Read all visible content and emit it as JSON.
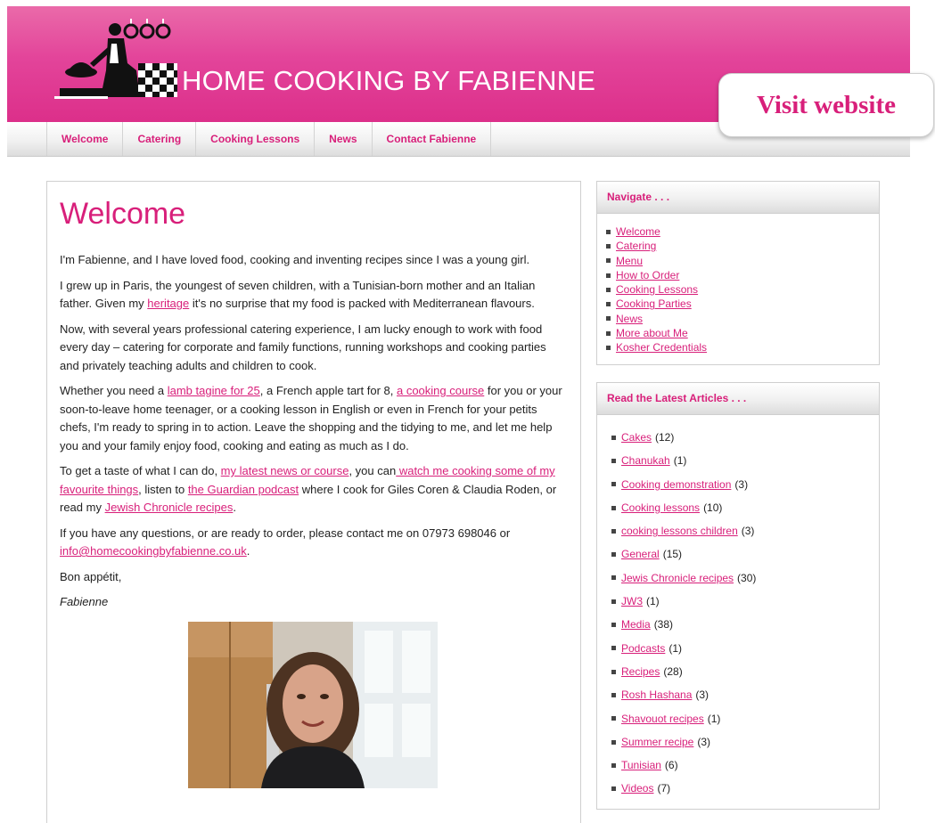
{
  "site": {
    "title": "HOME COOKING BY FABIENNE"
  },
  "topnav": [
    {
      "label": "Welcome"
    },
    {
      "label": "Catering"
    },
    {
      "label": "Cooking Lessons"
    },
    {
      "label": "News"
    },
    {
      "label": "Contact Fabienne"
    }
  ],
  "visit_label": "Visit website",
  "main": {
    "title": "Welcome",
    "p1": "I'm Fabienne, and I have loved food, cooking and inventing recipes since I was a young girl.",
    "p2": {
      "t1": "I grew up in Paris, the youngest of seven children, with a Tunisian-born mother and an Italian father. Given my ",
      "l1": "heritage",
      "t2": " it's no surprise that my food is packed with Mediterranean flavours."
    },
    "p3": "Now, with several years professional catering experience, I am lucky enough to work with food every day – catering for corporate and family functions, running workshops and cooking parties and privately teaching adults and children to cook.",
    "p4": {
      "t1": "Whether you need a ",
      "l1": "lamb tagine for 25",
      "t2": ", a French apple tart for 8, ",
      "l2": "a cooking course",
      "t3": " for you or your soon-to-leave home teenager, or a cooking lesson in English or even in French for your petits chefs, I'm ready to spring in to action. Leave the shopping and the tidying to me, and let me help you and your family enjoy food, cooking and eating as much as I do."
    },
    "p5": {
      "t1": "To get a taste of what I can do, ",
      "l1": "my latest news or course",
      "t2": ", you can",
      "l2": " watch me cooking some of my favourite things",
      "t3": ", listen to ",
      "l3": "the Guardian podcast",
      "t4": " where I cook for Giles Coren & Claudia Roden, or read my ",
      "l4": "Jewish Chronicle recipes",
      "t5": "."
    },
    "p6": {
      "t1": "If you have any questions, or are ready to order, please contact me on 07973 698046 or ",
      "l1": "info@homecookingbyfabienne.co.uk",
      "t2": "."
    },
    "closing": "Bon appétit,",
    "signature": "Fabienne"
  },
  "sidebar": {
    "navigate": {
      "title": "Navigate . . .",
      "items": [
        {
          "label": "Welcome"
        },
        {
          "label": "Catering"
        },
        {
          "label": "Menu"
        },
        {
          "label": "How to Order"
        },
        {
          "label": "Cooking Lessons"
        },
        {
          "label": "Cooking Parties"
        },
        {
          "label": "News"
        },
        {
          "label": "More about Me"
        },
        {
          "label": "Kosher Credentials"
        }
      ]
    },
    "articles": {
      "title": "Read the Latest Articles . . .",
      "items": [
        {
          "label": "Cakes",
          "count": "(12)"
        },
        {
          "label": "Chanukah",
          "count": "(1)"
        },
        {
          "label": "Cooking demonstration",
          "count": "(3)"
        },
        {
          "label": "Cooking lessons",
          "count": "(10)"
        },
        {
          "label": "cooking lessons children",
          "count": "(3)"
        },
        {
          "label": "General",
          "count": "(15)"
        },
        {
          "label": "Jewis Chronicle recipes",
          "count": "(30)"
        },
        {
          "label": "JW3",
          "count": "(1)"
        },
        {
          "label": "Media",
          "count": "(38)"
        },
        {
          "label": "Podcasts",
          "count": "(1)"
        },
        {
          "label": "Recipes",
          "count": "(28)"
        },
        {
          "label": "Rosh Hashana",
          "count": "(3)"
        },
        {
          "label": "Shavouot recipes",
          "count": "(1)"
        },
        {
          "label": "Summer recipe",
          "count": "(3)"
        },
        {
          "label": "Tunisian",
          "count": "(6)"
        },
        {
          "label": "Videos",
          "count": "(7)"
        }
      ]
    }
  },
  "colors": {
    "accent": "#d81f7a",
    "header_pink": "#e3449a"
  }
}
